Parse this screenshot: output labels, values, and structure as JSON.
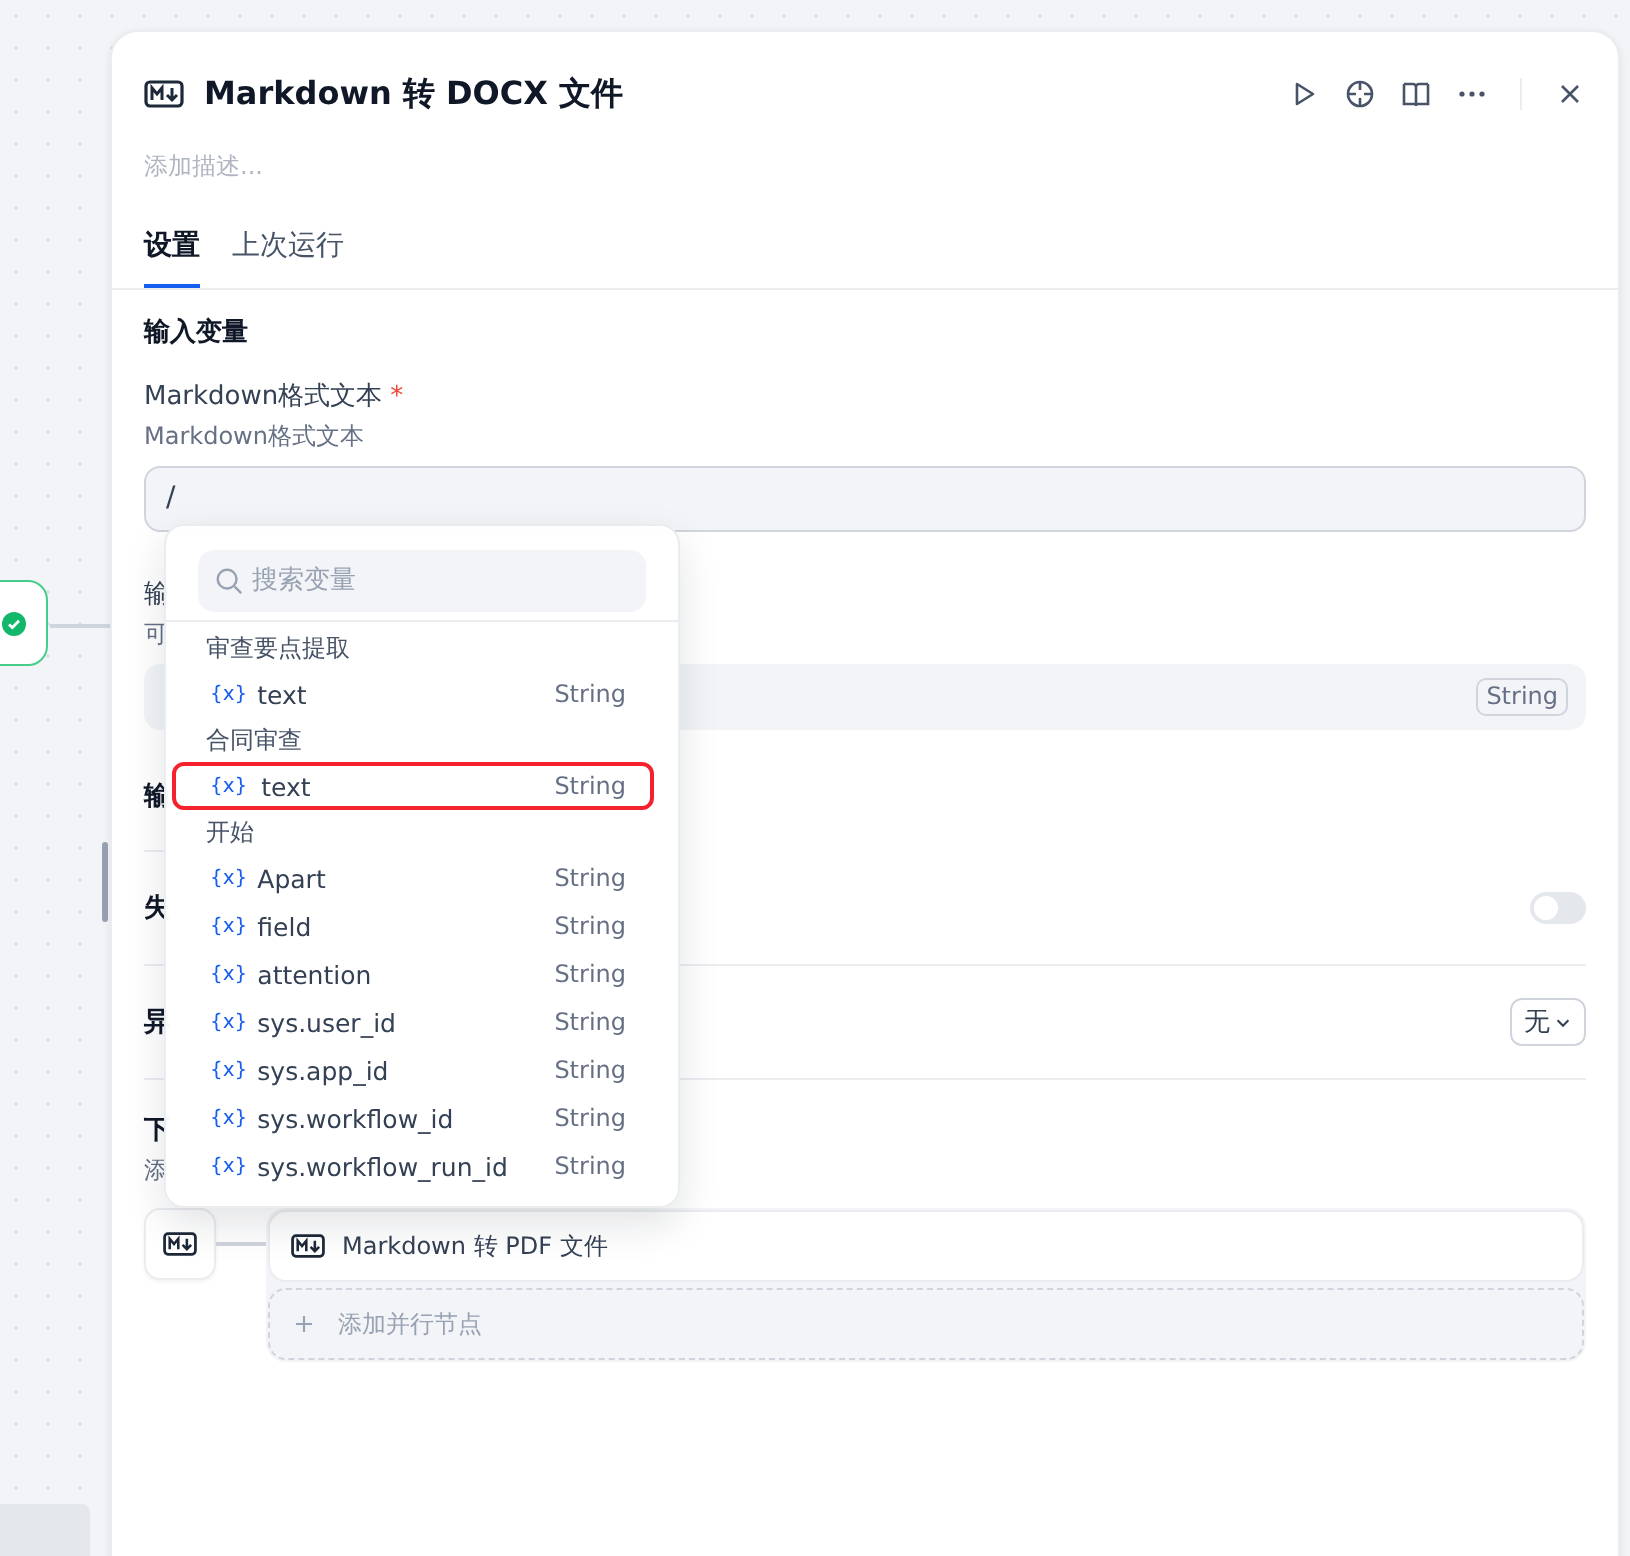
{
  "panel": {
    "title": "Markdown 转 DOCX 文件",
    "description_placeholder": "添加描述..."
  },
  "tabs": [
    {
      "label": "设置",
      "selected": true
    },
    {
      "label": "上次运行",
      "selected": false
    }
  ],
  "input_section": {
    "heading": "输入变量",
    "label": "Markdown格式文本",
    "required_mark": "*",
    "hint": "Markdown格式文本",
    "value": "/"
  },
  "output_filename": {
    "label": "输",
    "hint": "可",
    "type_tag": "String"
  },
  "output_section": {
    "heading": "输"
  },
  "retry": {
    "label": "失",
    "on": false
  },
  "error_handling": {
    "label": "异",
    "value": "无"
  },
  "next_step": {
    "heading": "下",
    "hint": "添",
    "nodes": [
      {
        "label": "Markdown 转 PDF 文件"
      }
    ],
    "add_parallel": "添加并行节点"
  },
  "variable_menu": {
    "placeholder": "搜索变量",
    "groups": [
      {
        "name": "审查要点提取",
        "items": [
          {
            "icon": "{x}",
            "name": "text",
            "type": "String",
            "selected": false
          }
        ]
      },
      {
        "name": "合同审查",
        "items": [
          {
            "icon": "{x}",
            "name": "text",
            "type": "String",
            "selected": true
          }
        ]
      },
      {
        "name": "开始",
        "items": [
          {
            "icon": "{x}",
            "name": "Apart",
            "type": "String",
            "selected": false
          },
          {
            "icon": "{x}",
            "name": "field",
            "type": "String",
            "selected": false
          },
          {
            "icon": "{x}",
            "name": "attention",
            "type": "String",
            "selected": false
          },
          {
            "icon": "{x}",
            "name": "sys.user_id",
            "type": "String",
            "selected": false
          },
          {
            "icon": "{x}",
            "name": "sys.app_id",
            "type": "String",
            "selected": false
          },
          {
            "icon": "{x}",
            "name": "sys.workflow_id",
            "type": "String",
            "selected": false
          },
          {
            "icon": "{x}",
            "name": "sys.workflow_run_id",
            "type": "String",
            "selected": false
          }
        ]
      }
    ]
  }
}
